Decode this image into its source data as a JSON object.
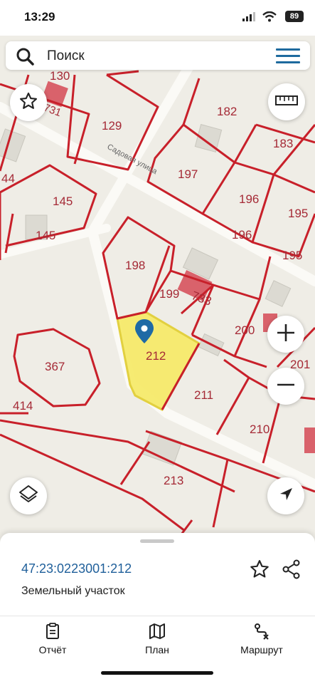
{
  "status_bar": {
    "time": "13:29",
    "battery": "89"
  },
  "search": {
    "placeholder": "Поиск"
  },
  "map": {
    "parcels": [
      "130",
      "731",
      "129",
      "182",
      "183",
      "44",
      "197",
      "196",
      "195",
      "145",
      "145",
      "196",
      "195",
      "198",
      "199",
      "733",
      "200",
      "212",
      "201",
      "367",
      "211",
      "414",
      "210",
      "213"
    ],
    "street": "Садовая улица",
    "selected_parcel": "212",
    "highlight_color": "#f5ea6a",
    "boundary_color": "#c8202a"
  },
  "sheet": {
    "cadastral_number": "47:23:0223001:212",
    "type": "Земельный участок"
  },
  "tabs": [
    {
      "label": "Отчёт",
      "icon": "report-icon"
    },
    {
      "label": "План",
      "icon": "map-icon"
    },
    {
      "label": "Маршрут",
      "icon": "route-icon"
    }
  ]
}
